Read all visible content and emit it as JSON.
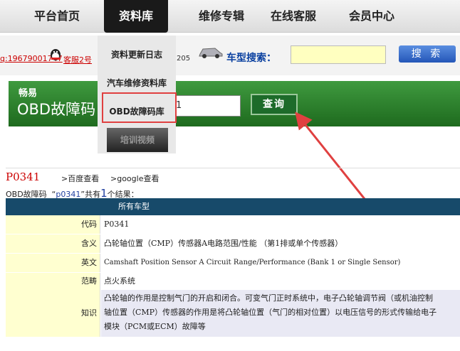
{
  "nav": {
    "items": [
      "平台首页",
      "资料库",
      "维修专辑",
      "在线客服",
      "会员中心"
    ]
  },
  "dropdown": {
    "items": [
      "资料更新日志",
      "汽车维修资料库",
      "OBD故障码库",
      "培训视频"
    ]
  },
  "infobar": {
    "qq1": "q:19679001747",
    "qq2": "客服2号",
    "num": "205",
    "car_search_label": "车型搜索：",
    "search_button": "搜 索"
  },
  "obd": {
    "small": "畅易",
    "big": "OBD故障码",
    "input_value": "1",
    "query_button": "查询"
  },
  "result": {
    "code": "P0341",
    "baidu": ">百度查看",
    "google": ">google查看",
    "summary_prefix": "OBD故障码",
    "summary_code": "p0341",
    "summary_mid": "共有",
    "summary_count": "1",
    "summary_suffix": "个结果：",
    "table_header": "所有车型",
    "rows": [
      {
        "label": "代码",
        "value": "P0341"
      },
      {
        "label": "含义",
        "value": "凸轮轴位置（CMP）传感器A电路范围/性能 （第1排或单个传感器）"
      },
      {
        "label": "英文",
        "value": "Camshaft Position Sensor A Circuit Range/Performance (Bank 1 or Single Sensor)"
      },
      {
        "label": "范畴",
        "value": "点火系统"
      },
      {
        "label": "知识",
        "lines": [
          "凸轮轴的作用是控制气门的开启和闭合。可变气门正时系统中，电子凸轮轴调节阀（或机油控制",
          "轴位置（CMP）传感器的作用是将凸轮轴位置（气门的相对位置）以电压信号的形式传输给电子",
          "模块（PCM或ECM）故障等"
        ]
      }
    ]
  },
  "colors": {
    "accent_red": "#e04040",
    "green": "#2a7a2a",
    "header_blue": "#174a6a"
  }
}
